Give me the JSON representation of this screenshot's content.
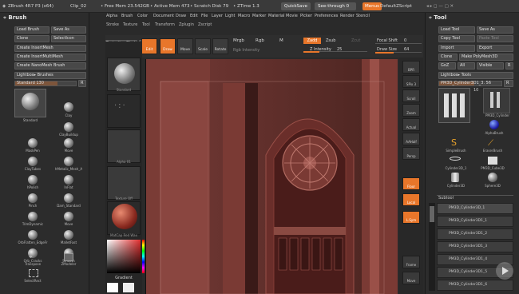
{
  "topbar": {
    "app_title": "ZBrush 4R7 P3 (x64)",
    "doc_name": "Clip_02",
    "free_mem": "• Free Mem 23.542GB",
    "active_mem": "• Active Mem 473",
    "scratch_disk": "• Scratch Disk 79",
    "ztime": "• ZTime 1.3",
    "quicksave": "QuickSave",
    "seethrough": "See-through",
    "seethrough_val": "0",
    "menus": "Menus",
    "default_script": "DefaultZScript"
  },
  "menubar": {
    "items": [
      "Alpha",
      "Brush",
      "Color",
      "Document",
      "Draw",
      "Edit",
      "File",
      "Layer",
      "Light",
      "Macro",
      "Marker",
      "Material",
      "Movie",
      "Picker",
      "Preferences",
      "Render",
      "Stencil"
    ],
    "sub_items": [
      "Stroke",
      "Texture",
      "Tool",
      "Transform",
      "Zplugin",
      "Zscript"
    ]
  },
  "brush_panel": {
    "title": "Brush",
    "load": "Load Brush",
    "save_as": "Save As",
    "clone": "Clone",
    "select_icon": "SelectIcon",
    "create_insert_mesh": "Create InsertMesh",
    "create_insert_multi": "Create InsertMultiMesh",
    "create_nanomesh": "Create NanoMesh Brush",
    "lightbox_brushes": "Lightbox▸ Brushes",
    "standard_label": "Standard",
    "standard_value": "130",
    "brushes": [
      "Standard",
      "Clay",
      "ClayBuildup",
      "MaskPen",
      "Move",
      "ClayTubes",
      "hMetalic_Mesh_A",
      "hPolish",
      "InFlat",
      "Pinch",
      "Dam_Standard",
      "TrimDynamic",
      "Move",
      "OrbFlatten_EdgeFr",
      "MalletFast",
      "Orb_Cracks",
      "Smooth",
      "Transpose",
      "ZModeler",
      "SelectRect"
    ]
  },
  "left_thumbs": {
    "standard": "Standard",
    "dots": "",
    "alpha": "Alpha 01",
    "texture": "Texture Off",
    "material": "MatCap Red Wax",
    "gradient": "Gradient"
  },
  "toolbar": {
    "projection_master": "Projection Master",
    "lightbox": "LightBox",
    "edit": "Edit",
    "draw": "Draw",
    "move": "Move",
    "scale": "Scale",
    "rotate": "Rotate",
    "mrgb": "Mrgb",
    "rgb": "Rgb",
    "m": "M",
    "rgb_intensity": "Rgb Intensity",
    "zadd": "Zadd",
    "zsub": "Zsub",
    "zcut": "Zcut",
    "z_intensity_label": "Z Intensity",
    "z_intensity_value": "25",
    "focal_shift_label": "Focal Shift",
    "focal_shift_value": "0",
    "draw_size_label": "Draw Size",
    "draw_size_value": "64",
    "dynamic": "Dynamic"
  },
  "right_tray": [
    "BPR",
    "SPix 3",
    "Scroll",
    "Zoom",
    "Actual",
    "AAHalf",
    "Persp",
    "Floor",
    "Local",
    "L.Sym",
    "Frame",
    "Move"
  ],
  "tool_panel": {
    "title": "Tool",
    "load_tool": "Load Tool",
    "save_as": "Save As",
    "copy_tool": "Copy Tool",
    "paste_tool": "Paste Tool",
    "import": "Import",
    "export": "Export",
    "clone": "Clone",
    "make_polymesh": "Make PolyMesh3D",
    "goz": "GoZ",
    "all": "All",
    "visible": "Visible",
    "r": "R",
    "lightbox_tools": "Lightbox▸ Tools",
    "current_tool": "PM3D_Cylinder3D1_3.",
    "current_value": "56",
    "tool_count": "10",
    "tools": [
      "PM3D_Cylinder",
      "AlphaBrush",
      "SimpleBrush",
      "EraserBrush",
      "Cylinder3D_1",
      "PM3D_Cube3D",
      "Cylinder3D",
      "Sphere3D"
    ],
    "subtool_title": "Subtool",
    "subtools": [
      "PM3D_Cylinder3D_1",
      "PM3D_Cylinder3D1_1",
      "PM3D_Cylinder3D1_2",
      "PM3D_Cylinder3D1_3",
      "PM3D_Cylinder3D1_4",
      "PM3D_Cylinder3D1_5",
      "PM3D_Cylinder3D1_6"
    ]
  },
  "colors": {
    "accent": "#e8762a",
    "panel": "#2c2c2c",
    "canvas": "#3a2220"
  }
}
